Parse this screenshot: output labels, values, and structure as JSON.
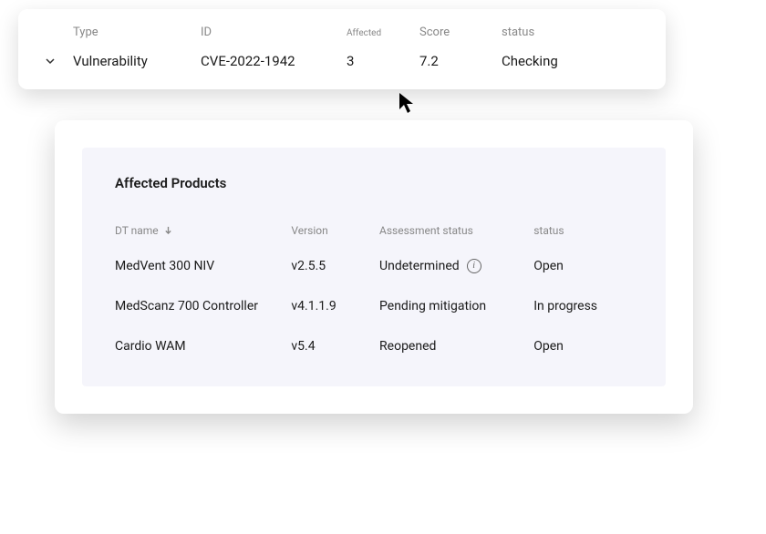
{
  "main": {
    "headers": {
      "type": "Type",
      "id": "ID",
      "affected": "Affected",
      "score": "Score",
      "status": "status"
    },
    "row": {
      "type": "Vulnerability",
      "id": "CVE-2022-1942",
      "affected": "3",
      "score": "7.2",
      "status": "Checking"
    }
  },
  "detail": {
    "title": "Affected Products",
    "headers": {
      "dt_name": "DT name",
      "version": "Version",
      "assessment_status": "Assessment status",
      "status": "status"
    },
    "rows": [
      {
        "dt_name": "MedVent 300 NIV",
        "version": "v2.5.5",
        "assessment_status": "Undetermined",
        "has_info": true,
        "status": "Open"
      },
      {
        "dt_name": "MedScanz 700 Controller",
        "version": "v4.1.1.9",
        "assessment_status": "Pending mitigation",
        "has_info": false,
        "status": "In progress"
      },
      {
        "dt_name": "Cardio WAM",
        "version": "v5.4",
        "assessment_status": "Reopened",
        "has_info": false,
        "status": "Open"
      }
    ]
  }
}
